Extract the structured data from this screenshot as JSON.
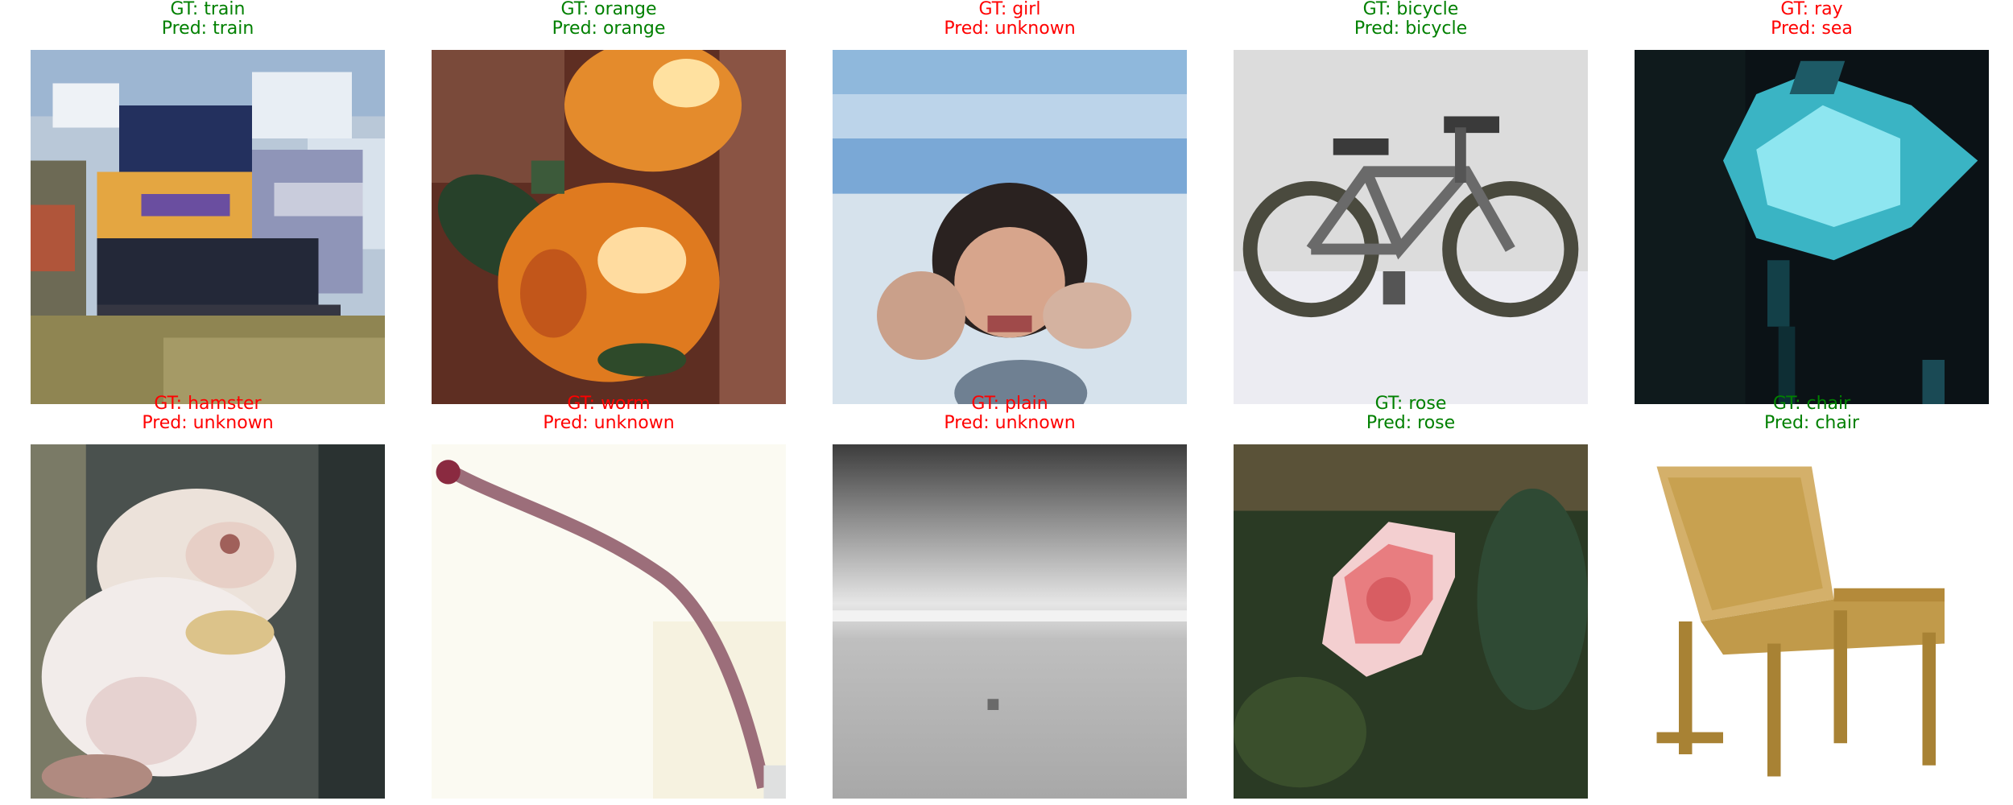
{
  "colors": {
    "correct": "#008000",
    "incorrect": "#ff0000"
  },
  "samples": [
    {
      "gt": "GT: train",
      "pred": "Pred: train",
      "correct": true,
      "image_subject": "train"
    },
    {
      "gt": "GT: orange",
      "pred": "Pred: orange",
      "correct": true,
      "image_subject": "orange"
    },
    {
      "gt": "GT: girl",
      "pred": "Pred: unknown",
      "correct": false,
      "image_subject": "girl"
    },
    {
      "gt": "GT: bicycle",
      "pred": "Pred: bicycle",
      "correct": true,
      "image_subject": "bicycle"
    },
    {
      "gt": "GT: ray",
      "pred": "Pred: sea",
      "correct": false,
      "image_subject": "ray"
    },
    {
      "gt": "GT: hamster",
      "pred": "Pred: unknown",
      "correct": false,
      "image_subject": "hamster"
    },
    {
      "gt": "GT: worm",
      "pred": "Pred: unknown",
      "correct": false,
      "image_subject": "worm"
    },
    {
      "gt": "GT: plain",
      "pred": "Pred: unknown",
      "correct": false,
      "image_subject": "plain"
    },
    {
      "gt": "GT: rose",
      "pred": "Pred: rose",
      "correct": true,
      "image_subject": "rose"
    },
    {
      "gt": "GT: chair",
      "pred": "Pred: chair",
      "correct": true,
      "image_subject": "chair"
    }
  ]
}
